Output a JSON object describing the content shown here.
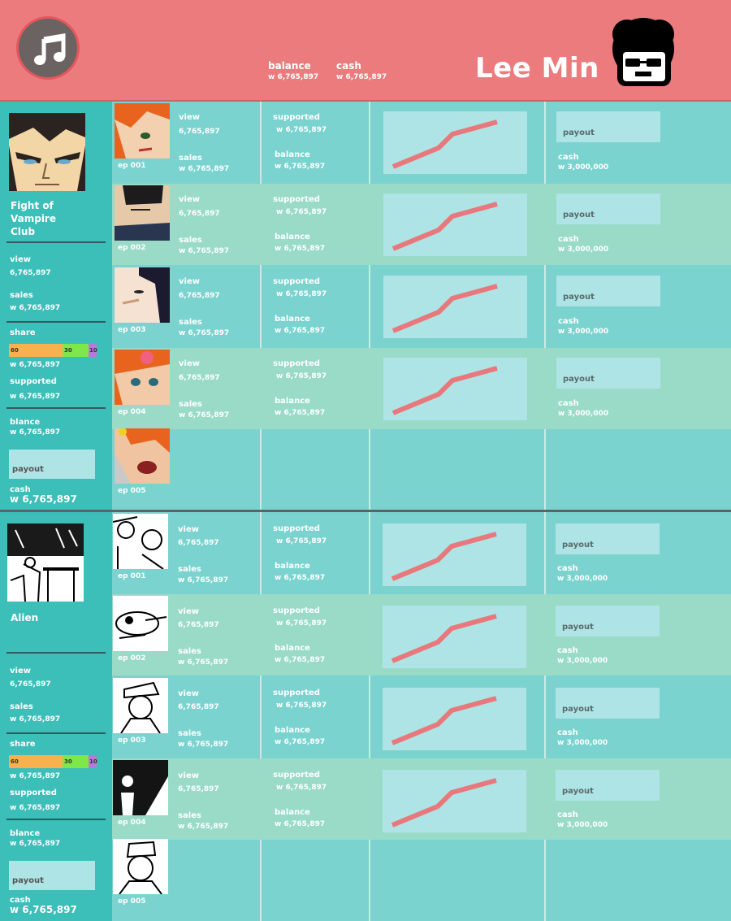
{
  "header": {
    "balance_label": "balance",
    "balance_value": "w 6,765,897",
    "cash_label": "cash",
    "cash_value": "w 6,765,897",
    "user_name": "Lee Min",
    "accent": "#ec7b7e"
  },
  "series": [
    {
      "title": "Fight of Vampire Club",
      "view_label": "view",
      "view_value": "6,765,897",
      "sales_label": "sales",
      "sales_value": "w 6,765,897",
      "share_label": "share",
      "share": [
        "60",
        "30",
        "10"
      ],
      "share_value": "w 6,765,897",
      "supported_label": "supported",
      "supported_value": "w 6,765,897",
      "balance_label": "blance",
      "balance_value": "w 6,765,897",
      "payout_label": "payout",
      "cash_label": "cash",
      "cash_value": "w  6,765,897",
      "episodes": [
        {
          "ep": "ep 001",
          "view_label": "view",
          "view": "6,765,897",
          "sales_label": "sales",
          "sales": "w 6,765,897",
          "supported_label": "supported",
          "supported": "w 6,765,897",
          "balance_label": "balance",
          "balance": "w 6,765,897",
          "payout_label": "payout",
          "cash_label": "cash",
          "cash": "w 3,000,000"
        },
        {
          "ep": "ep 002",
          "view_label": "view",
          "view": "6,765,897",
          "sales_label": "sales",
          "sales": "w 6,765,897",
          "supported_label": "supported",
          "supported": "w 6,765,897",
          "balance_label": "balance",
          "balance": "w 6,765,897",
          "payout_label": "payout",
          "cash_label": "cash",
          "cash": "w 3,000,000"
        },
        {
          "ep": "ep 003",
          "view_label": "view",
          "view": "6,765,897",
          "sales_label": "sales",
          "sales": "w 6,765,897",
          "supported_label": "supported",
          "supported": "w 6,765,897",
          "balance_label": "balance",
          "balance": "w 6,765,897",
          "payout_label": "payout",
          "cash_label": "cash",
          "cash": "w 3,000,000"
        },
        {
          "ep": "ep 004",
          "view_label": "view",
          "view": "6,765,897",
          "sales_label": "sales",
          "sales": "w 6,765,897",
          "supported_label": "supported",
          "supported": "w 6,765,897",
          "balance_label": "balance",
          "balance": "w 6,765,897",
          "payout_label": "payout",
          "cash_label": "cash",
          "cash": "w 3,000,000"
        },
        {
          "ep": "ep 005"
        }
      ]
    },
    {
      "title": "Alien",
      "view_label": "view",
      "view_value": "6,765,897",
      "sales_label": "sales",
      "sales_value": "w 6,765,897",
      "share_label": "share",
      "share": [
        "60",
        "30",
        "10"
      ],
      "share_value": "w 6,765,897",
      "supported_label": "supported",
      "supported_value": "w 6,765,897",
      "balance_label": "blance",
      "balance_value": "w 6,765,897",
      "payout_label": "payout",
      "cash_label": "cash",
      "cash_value": "w  6,765,897",
      "episodes": [
        {
          "ep": "ep 001",
          "view_label": "view",
          "view": "6,765,897",
          "sales_label": "sales",
          "sales": "w 6,765,897",
          "supported_label": "supported",
          "supported": "w 6,765,897",
          "balance_label": "balance",
          "balance": "w 6,765,897",
          "payout_label": "payout",
          "cash_label": "cash",
          "cash": "w 3,000,000"
        },
        {
          "ep": "ep 002",
          "view_label": "view",
          "view": "6,765,897",
          "sales_label": "sales",
          "sales": "w 6,765,897",
          "supported_label": "supported",
          "supported": "w 6,765,897",
          "balance_label": "balance",
          "balance": "w 6,765,897",
          "payout_label": "payout",
          "cash_label": "cash",
          "cash": "w 3,000,000"
        },
        {
          "ep": "ep 003",
          "view_label": "view",
          "view": "6,765,897",
          "sales_label": "sales",
          "sales": "w 6,765,897",
          "supported_label": "supported",
          "supported": "w 6,765,897",
          "balance_label": "balance",
          "balance": "w 6,765,897",
          "payout_label": "payout",
          "cash_label": "cash",
          "cash": "w 3,000,000"
        },
        {
          "ep": "ep 004",
          "view_label": "view",
          "view": "6,765,897",
          "sales_label": "sales",
          "sales": "w 6,765,897",
          "supported_label": "supported",
          "supported": "w 6,765,897",
          "balance_label": "balance",
          "balance": "w 6,765,897",
          "payout_label": "payout",
          "cash_label": "cash",
          "cash": "w 3,000,000"
        },
        {
          "ep": "ep 005"
        }
      ]
    }
  ],
  "colors": {
    "sidebar": "#3cbeb9",
    "row": "#7ad3cf",
    "row_alt": "#99dbc7",
    "trend_line": "#e8787b",
    "share_60": "#f7b24e",
    "share_30": "#7ee84a",
    "share_10": "#b67ad9"
  }
}
